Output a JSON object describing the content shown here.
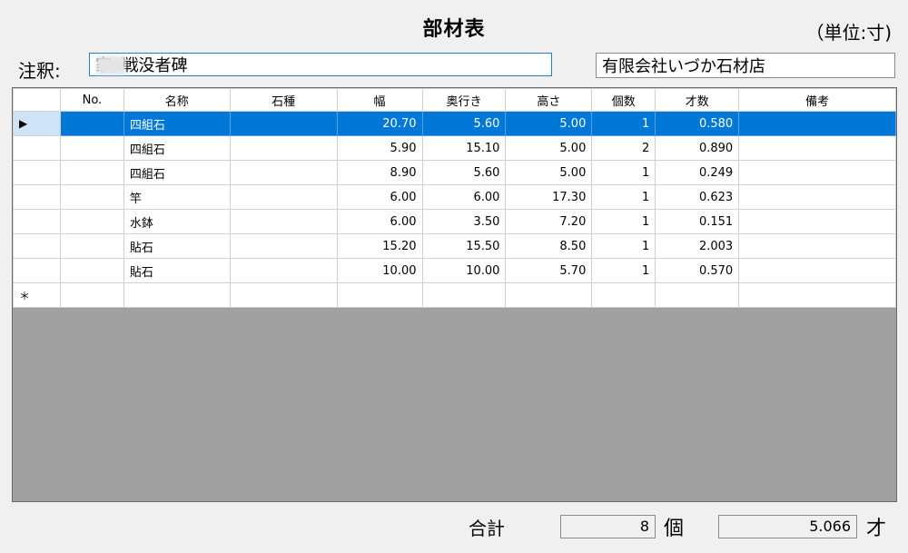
{
  "title": "部材表",
  "unit_label": "（単位:寸)",
  "note": {
    "label": "注釈:",
    "value": "家  戦没者碑"
  },
  "company": {
    "value": "有限会社いづか石材店"
  },
  "grid": {
    "columns": [
      "",
      "No.",
      "名称",
      "石種",
      "幅",
      "奥行き",
      "高さ",
      "個数",
      "才数",
      "備考"
    ],
    "rows": [
      {
        "marker": "▶",
        "no": "",
        "name": "四組石",
        "stone": "",
        "width": "20.70",
        "depth": "5.60",
        "height": "5.00",
        "count": "1",
        "sai": "0.580",
        "remarks": ""
      },
      {
        "marker": "",
        "no": "",
        "name": "四組石",
        "stone": "",
        "width": "5.90",
        "depth": "15.10",
        "height": "5.00",
        "count": "2",
        "sai": "0.890",
        "remarks": ""
      },
      {
        "marker": "",
        "no": "",
        "name": "四組石",
        "stone": "",
        "width": "8.90",
        "depth": "5.60",
        "height": "5.00",
        "count": "1",
        "sai": "0.249",
        "remarks": ""
      },
      {
        "marker": "",
        "no": "",
        "name": "竿",
        "stone": "",
        "width": "6.00",
        "depth": "6.00",
        "height": "17.30",
        "count": "1",
        "sai": "0.623",
        "remarks": ""
      },
      {
        "marker": "",
        "no": "",
        "name": "水鉢",
        "stone": "",
        "width": "6.00",
        "depth": "3.50",
        "height": "7.20",
        "count": "1",
        "sai": "0.151",
        "remarks": ""
      },
      {
        "marker": "",
        "no": "",
        "name": "貼石",
        "stone": "",
        "width": "15.20",
        "depth": "15.50",
        "height": "8.50",
        "count": "1",
        "sai": "2.003",
        "remarks": ""
      },
      {
        "marker": "",
        "no": "",
        "name": "貼石",
        "stone": "",
        "width": "10.00",
        "depth": "10.00",
        "height": "5.70",
        "count": "1",
        "sai": "0.570",
        "remarks": ""
      }
    ],
    "new_row_marker": "＊"
  },
  "totals": {
    "label": "合計",
    "count_value": "8",
    "count_unit": "個",
    "sai_value": "5.066",
    "sai_unit": "才"
  }
}
